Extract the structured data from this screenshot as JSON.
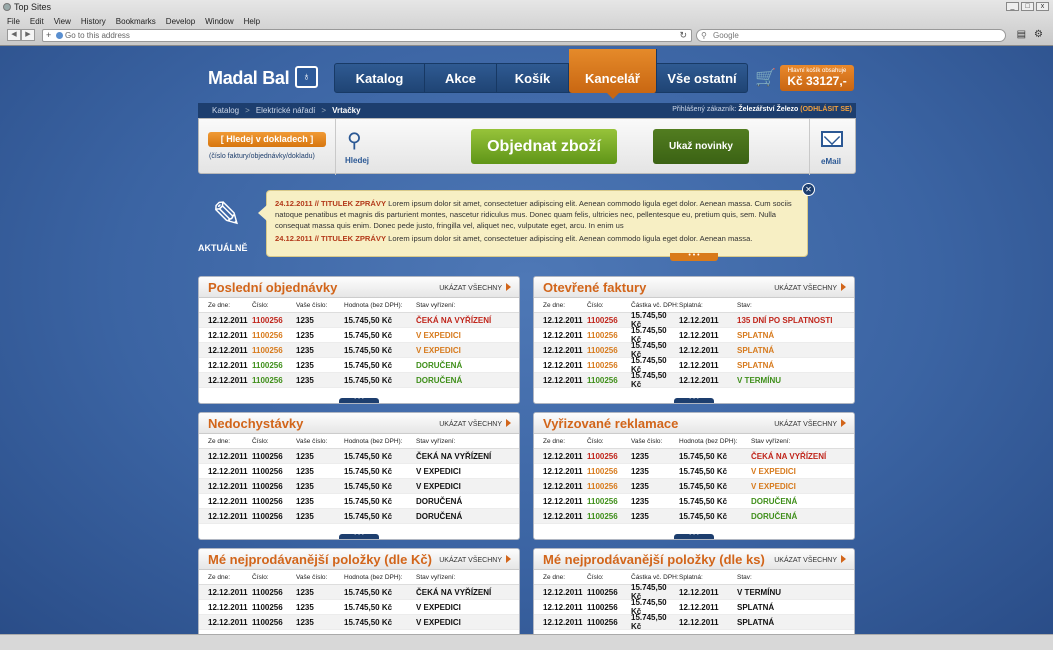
{
  "browser": {
    "window_title": "Top Sites",
    "menu": [
      "File",
      "Edit",
      "View",
      "History",
      "Bookmarks",
      "Develop",
      "Window",
      "Help"
    ],
    "address_placeholder": "Go to this address",
    "search_placeholder": "Google"
  },
  "site": {
    "logo": "Madal Bal",
    "nav": [
      "Katalog",
      "Akce",
      "Košík",
      "Kancelář",
      "Vše ostatní"
    ],
    "cart_label": "Hlavní košík obsahuje",
    "cart_value": "Kč 33127,-",
    "breadcrumb": [
      "Katalog",
      "Elektrické nářadí",
      "Vrtačky"
    ],
    "login_label": "Přihlášený zákazník:",
    "login_name": "Železářství Železo",
    "logout": "(ODHLÁSIT SE)",
    "search_button": "[ Hledej v dokladech ]",
    "search_hint": "(číslo faktury/objednávky/dokladu)",
    "search_icon_label": "Hledej",
    "order_button": "Objednat zboží",
    "news_button": "Ukaž novinky",
    "mail_label": "eMail",
    "news_section_label": "AKTUÁLNĚ",
    "news": [
      {
        "date": "24.12.2011 //",
        "title": "TITULEK ZPRÁVY",
        "text": "Lorem ipsum dolor sit amet, consectetuer adipiscing elit. Aenean commodo ligula eget dolor. Aenean massa. Cum sociis natoque penatibus et magnis dis parturient montes, nascetur ridiculus mus. Donec quam felis, ultricies nec, pellentesque eu, pretium quis, sem. Nulla consequat massa quis enim. Donec pede justo, fringilla vel, aliquet nec, vulputate eget, arcu. In enim us"
      },
      {
        "date": "24.12.2011 //",
        "title": "TITULEK ZPRÁVY",
        "text": "Lorem ipsum dolor sit amet, consectetuer adipiscing elit. Aenean commodo ligula eget dolor. Aenean massa."
      }
    ],
    "show_all": "UKÁZAT VŠECHNY"
  },
  "panels": {
    "p1": {
      "title": "Poslední objednávky",
      "headers": [
        "Ze dne:",
        "Číslo:",
        "Vaše číslo:",
        "Hodnota (bez DPH):",
        "Stav vyřízení:"
      ],
      "rows": [
        [
          "12.12.2011",
          "1100256",
          "1235",
          "15.745,50 Kč",
          "ČEKÁ NA VYŘÍZENÍ"
        ],
        [
          "12.12.2011",
          "1100256",
          "1235",
          "15.745,50 Kč",
          "V EXPEDICI"
        ],
        [
          "12.12.2011",
          "1100256",
          "1235",
          "15.745,50 Kč",
          "V EXPEDICI"
        ],
        [
          "12.12.2011",
          "1100256",
          "1235",
          "15.745,50 Kč",
          "DORUČENÁ"
        ],
        [
          "12.12.2011",
          "1100256",
          "1235",
          "15.745,50 Kč",
          "DORUČENÁ"
        ]
      ]
    },
    "p2": {
      "title": "Otevřené faktury",
      "headers": [
        "Ze dne:",
        "Číslo:",
        "Částka vč. DPH:",
        "Splatná:",
        "Stav:"
      ],
      "rows": [
        [
          "12.12.2011",
          "1100256",
          "15.745,50 Kč",
          "12.12.2011",
          "135 DNÍ PO SPLATNOSTI"
        ],
        [
          "12.12.2011",
          "1100256",
          "15.745,50 Kč",
          "12.12.2011",
          "SPLATNÁ"
        ],
        [
          "12.12.2011",
          "1100256",
          "15.745,50 Kč",
          "12.12.2011",
          "SPLATNÁ"
        ],
        [
          "12.12.2011",
          "1100256",
          "15.745,50 Kč",
          "12.12.2011",
          "SPLATNÁ"
        ],
        [
          "12.12.2011",
          "1100256",
          "15.745,50 Kč",
          "12.12.2011",
          "V TERMÍNU"
        ]
      ]
    },
    "p3": {
      "title": "Nedochystávky",
      "headers": [
        "Ze dne:",
        "Číslo:",
        "Vaše číslo:",
        "Hodnota (bez DPH):",
        "Stav vyřízení:"
      ],
      "rows": [
        [
          "12.12.2011",
          "1100256",
          "1235",
          "15.745,50 Kč",
          "ČEKÁ NA VYŘÍZENÍ"
        ],
        [
          "12.12.2011",
          "1100256",
          "1235",
          "15.745,50 Kč",
          "V EXPEDICI"
        ],
        [
          "12.12.2011",
          "1100256",
          "1235",
          "15.745,50 Kč",
          "V EXPEDICI"
        ],
        [
          "12.12.2011",
          "1100256",
          "1235",
          "15.745,50 Kč",
          "DORUČENÁ"
        ],
        [
          "12.12.2011",
          "1100256",
          "1235",
          "15.745,50 Kč",
          "DORUČENÁ"
        ]
      ]
    },
    "p4": {
      "title": "Vyřizované reklamace",
      "headers": [
        "Ze dne:",
        "Číslo:",
        "Vaše číslo:",
        "Hodnota (bez DPH):",
        "Stav vyřízení:"
      ],
      "rows": [
        [
          "12.12.2011",
          "1100256",
          "1235",
          "15.745,50 Kč",
          "ČEKÁ NA VYŘÍZENÍ"
        ],
        [
          "12.12.2011",
          "1100256",
          "1235",
          "15.745,50 Kč",
          "V EXPEDICI"
        ],
        [
          "12.12.2011",
          "1100256",
          "1235",
          "15.745,50 Kč",
          "V EXPEDICI"
        ],
        [
          "12.12.2011",
          "1100256",
          "1235",
          "15.745,50 Kč",
          "DORUČENÁ"
        ],
        [
          "12.12.2011",
          "1100256",
          "1235",
          "15.745,50 Kč",
          "DORUČENÁ"
        ]
      ]
    },
    "p5": {
      "title": "Mé nejprodávanější položky (dle Kč)",
      "headers": [
        "Ze dne:",
        "Číslo:",
        "Vaše číslo:",
        "Hodnota (bez DPH):",
        "Stav vyřízení:"
      ],
      "rows": [
        [
          "12.12.2011",
          "1100256",
          "1235",
          "15.745,50 Kč",
          "ČEKÁ NA VYŘÍZENÍ"
        ],
        [
          "12.12.2011",
          "1100256",
          "1235",
          "15.745,50 Kč",
          "V EXPEDICI"
        ],
        [
          "12.12.2011",
          "1100256",
          "1235",
          "15.745,50 Kč",
          "V EXPEDICI"
        ]
      ]
    },
    "p6": {
      "title": "Mé nejprodávanější položky (dle ks)",
      "headers": [
        "Ze dne:",
        "Číslo:",
        "Částka vč. DPH:",
        "Splatná:",
        "Stav:"
      ],
      "rows": [
        [
          "12.12.2011",
          "1100256",
          "15.745,50 Kč",
          "12.12.2011",
          "V TERMÍNU"
        ],
        [
          "12.12.2011",
          "1100256",
          "15.745,50 Kč",
          "12.12.2011",
          "SPLATNÁ"
        ],
        [
          "12.12.2011",
          "1100256",
          "15.745,50 Kč",
          "12.12.2011",
          "SPLATNÁ"
        ]
      ]
    }
  },
  "colors": {
    "accent": "#d2651a",
    "brand_blue": "#1d3e6e",
    "green": "#6fa322",
    "red": "#c0251b"
  }
}
